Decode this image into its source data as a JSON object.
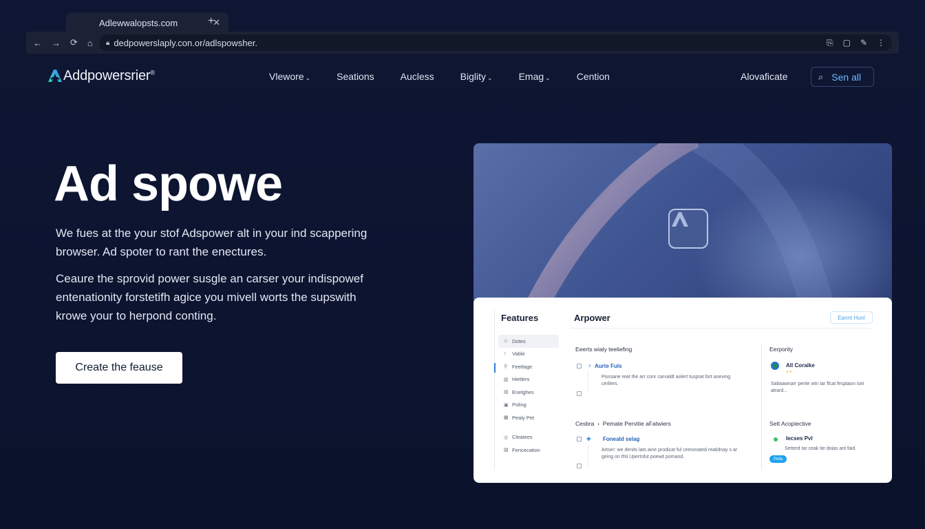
{
  "browser": {
    "tab_title": "Adlewwalopsts.com",
    "tab_close": "✕",
    "new_tab": "+",
    "url": "dedpowerslaply.con.or/adlspowsher.",
    "nav": {
      "back": "←",
      "forward": "→",
      "reload": "⟳",
      "home": "⌂"
    },
    "right_icons": [
      "⎘",
      "▢",
      "✎",
      "⋮"
    ]
  },
  "header": {
    "logo_text": "Addpowersrier",
    "logo_sup": "®",
    "nav_items": [
      {
        "label": "Vlewore",
        "caret": "⌄"
      },
      {
        "label": "Seations",
        "caret": ""
      },
      {
        "label": "Aucless",
        "caret": ""
      },
      {
        "label": "Biglity",
        "caret": "⌄"
      },
      {
        "label": "Emag",
        "caret": "⌄"
      },
      {
        "label": "Cention",
        "caret": ""
      }
    ],
    "cta_label": "Alovaficate",
    "search_label": "Sen all",
    "search_icon": "⌕"
  },
  "hero": {
    "title": "Ad spowe",
    "paragraph1": "We fues at the your stof Adspower alt in your ind scappering browser. Ad spoter to rant the enectures.",
    "paragraph2": "Ceaure the sprovid power susgle an carser your indispowef entenationity forstetifh agice you mivell worts the supswith krowe your to herpond conting.",
    "button_label": "Create the feause"
  },
  "preview": {
    "app_icon": "A",
    "dashboard": {
      "side_title": "Features",
      "main_title": "Arpower",
      "action_button": "Eannt Hunl",
      "side_items": [
        {
          "icon": "◇",
          "label": "Dotes"
        },
        {
          "icon": "↕",
          "label": "Vable"
        },
        {
          "icon": "⚲",
          "label": "Feetlage"
        },
        {
          "icon": "▥",
          "label": "Hietlers"
        },
        {
          "icon": "▤",
          "label": "Enetghes"
        },
        {
          "icon": "▣",
          "label": "Poling"
        },
        {
          "icon": "▦",
          "label": "Pealy Pet"
        },
        {
          "icon": "◎",
          "label": "Cleatees"
        },
        {
          "icon": "▧",
          "label": "Fencecation"
        }
      ],
      "left_section_title": "Eeerts wialy teeliefing",
      "row1": {
        "title": "Aurte Fuls",
        "text": "Ponsane reat the arr conr carvaldt aolert tusprat fort aneving cerliers."
      },
      "breadcrumb": [
        "Cesbra",
        "›",
        "Pemate Pervitie aFatwiers"
      ],
      "row2": {
        "title": "Foneald selag",
        "text": "Artser: we denits lats aine prodicat ful cemonated reatidnay s ar geing on thti Upertnfut poewit pomand."
      },
      "right_section_title": "Eerpority",
      "right_row1": {
        "title": "All Coraike",
        "stars": "★★",
        "text": "Saltaawnarr penle wtn tar flcat fesptaon isei atrard..."
      },
      "right_section_title2": "Sett Acopiective",
      "right_row2": {
        "title": "Iecses Pvl",
        "text": "Setterd tar ceak tie doias ant faid.",
        "pill": "Pella"
      }
    }
  }
}
